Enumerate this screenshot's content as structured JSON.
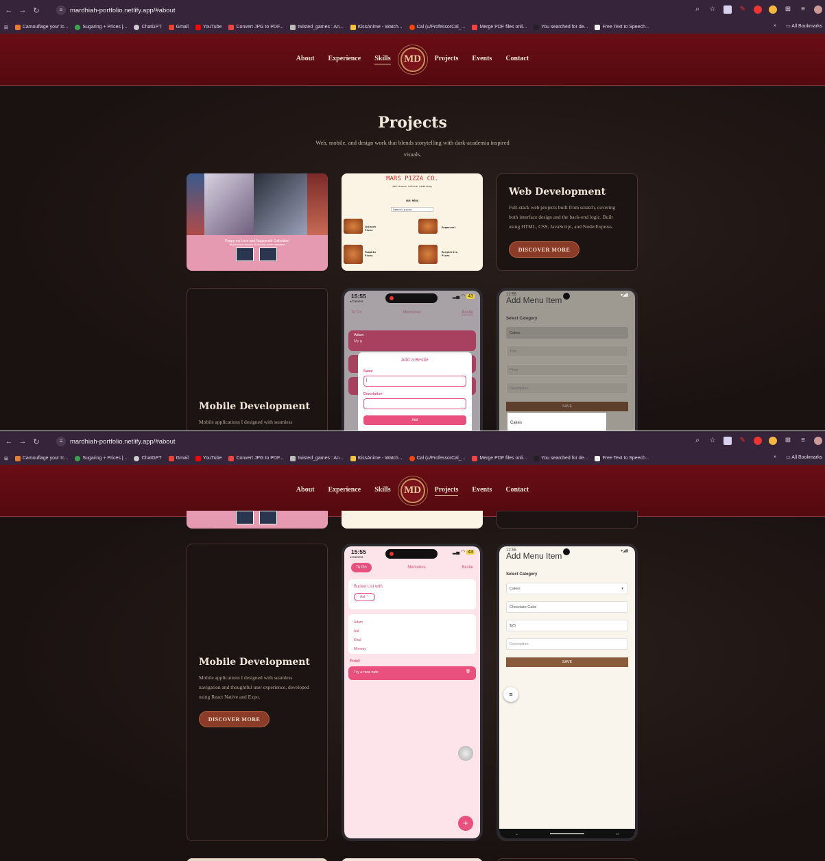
{
  "browser": {
    "url": "mardhiah-portfolio.netlify.app/#about",
    "bookmarks": [
      "Camouflage your Ic...",
      "Sugaring + Prices |...",
      "ChatGPT",
      "Gmail",
      "YouTube",
      "Convert JPG to PDF...",
      "twisted_games : An...",
      "KissAnime - Watch...",
      "Cal (u/ProfessorCal_...",
      "Merge PDF files onli...",
      "You searched for de...",
      "Free Text to Speech..."
    ],
    "overflow": "»",
    "all_bookmarks": "All Bookmarks"
  },
  "nav": {
    "items": [
      "About",
      "Experience",
      "Skills",
      "Projects",
      "Events",
      "Contact"
    ],
    "logo": "MD",
    "active_top": "Skills",
    "active_bottom": "Projects"
  },
  "projects": {
    "heading": "Projects",
    "subtitle_line1": "Web, mobile, and design work that blends storytelling with dark-academia inspired",
    "subtitle_line2": "visuals."
  },
  "web_card": {
    "title": "Web Development",
    "desc_lines": [
      "Full-stack web projects built from scratch, covering",
      "both interface design and the back-end logic. Built",
      "using HTML, CSS, JavaScript, and Node/Express."
    ],
    "button": "DISCOVER MORE"
  },
  "mobile_card": {
    "title": "Mobile Development",
    "desc_lines": [
      "Mobile applications I designed with seamless",
      "navigation and thoughtful user experience, developed",
      "using React Native and Expo."
    ],
    "button": "DISCOVER MORE"
  },
  "anime_card": {
    "caption": "Poppy my Love and Nagayoshi Collection!",
    "subcaption": "My personal collection of favourite anime characters"
  },
  "pizza_card": {
    "title": "MARS PIZZA CO.",
    "subtitle": "delicious online ordering",
    "menu_label": "OUR MENU",
    "search": "Search pizza",
    "items": [
      "Spinach Pizza",
      "Pepperoni",
      "Pumpkin Pizza",
      "Margherita Pizza"
    ]
  },
  "bestie_app": {
    "time": "15:55",
    "back": "◂ Camera",
    "battery": "43",
    "tabs": [
      "To Do",
      "Memories",
      "Bestie"
    ],
    "bestie_name": "Adam",
    "bestie_sub": "My g",
    "modal_title": "Add a Bestie",
    "name_label": "Name",
    "desc_label": "Description",
    "add_button": "Add",
    "bucket_title": "Bucket List with",
    "chip": "Aal",
    "dropdown": [
      "Adam",
      "Aal",
      "Khai",
      "Mommy"
    ],
    "section": "Food",
    "task": "Try a new cafe"
  },
  "menu_app": {
    "time": "12:55",
    "title": "Add Menu Item",
    "category_label": "Select Category",
    "category_value": "Cakes",
    "title_placeholder": "Title",
    "price_placeholder": "Price",
    "desc_placeholder": "Description",
    "title_value": "Chocolate Cake",
    "price_value": "$25",
    "save": "SAVE",
    "dropdown_option": "Cakes"
  },
  "colors": {
    "nav": "#6a0d14",
    "accent": "#8b3c28",
    "pink": "#e9507d",
    "bg": "#1e1614"
  }
}
